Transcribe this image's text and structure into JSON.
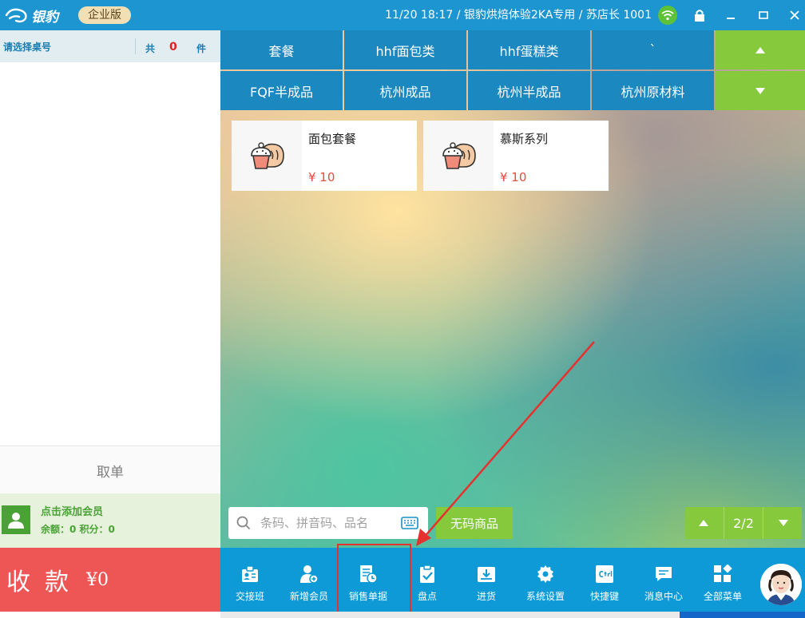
{
  "titlebar": {
    "logo_text": "银豹",
    "edition": "企业版",
    "status": "11/20 18:17 / 银豹烘焙体验2KA专用 / 苏店长 1001"
  },
  "left": {
    "table_label": "请选择桌号",
    "count_prefix": "共",
    "count": "0",
    "count_suffix": "件",
    "cancel": "取单",
    "member_add": "点击添加会员",
    "member_balance": "余额：0 积分：0",
    "pay_label": "收款",
    "pay_amount": "¥0"
  },
  "categories": {
    "row1": [
      "套餐",
      "hhf面包类",
      "hhf蛋糕类",
      "`"
    ],
    "row2": [
      "FQF半成品",
      "杭州成品",
      "杭州半成品",
      "杭州原材料"
    ]
  },
  "products": [
    {
      "name": "面包套餐",
      "price": "¥ 10"
    },
    {
      "name": "慕斯系列",
      "price": "¥ 10"
    }
  ],
  "search": {
    "placeholder": "条码、拼音码、品名"
  },
  "nocode_button": "无码商品",
  "pager": {
    "page": "2/2"
  },
  "toolbar": [
    {
      "label": "交接班",
      "icon": "shift-icon"
    },
    {
      "label": "新增会员",
      "icon": "add-member-icon"
    },
    {
      "label": "销售单据",
      "icon": "sales-receipt-icon"
    },
    {
      "label": "盘点",
      "icon": "inventory-check-icon"
    },
    {
      "label": "进货",
      "icon": "stock-in-icon"
    },
    {
      "label": "系统设置",
      "icon": "settings-icon"
    },
    {
      "label": "快捷键",
      "icon": "shortcut-icon"
    },
    {
      "label": "消息中心",
      "icon": "message-icon"
    },
    {
      "label": "全部菜单",
      "icon": "all-menu-icon"
    }
  ],
  "colors": {
    "header_blue": "#1d95d1",
    "category_blue": "#1b88c0",
    "green": "#86c93d",
    "pay_red": "#ee5555",
    "price_red": "#e84b3c",
    "highlight_red": "#e5312f"
  }
}
